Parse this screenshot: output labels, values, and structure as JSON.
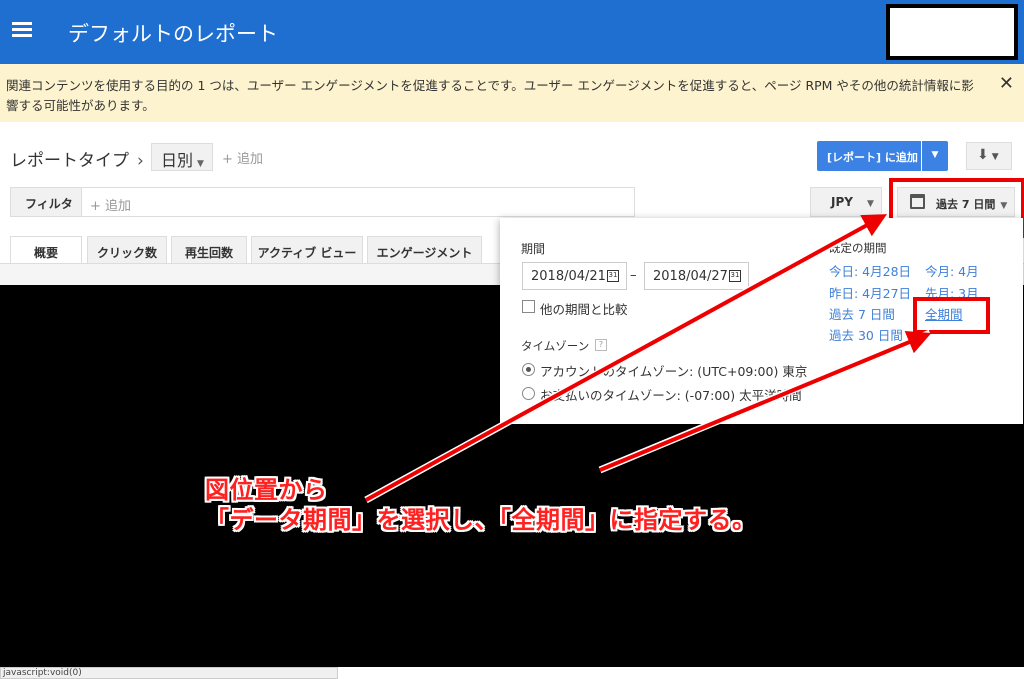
{
  "header": {
    "title": "デフォルトのレポート"
  },
  "notice": {
    "text": "関連コンテンツを使用する目的の 1 つは、ユーザー エンゲージメントを促進することです。ユーザー エンゲージメントを促進すると、ページ RPM やその他の統計情報に影響する可能性があります。",
    "close": "✕"
  },
  "toolbar": {
    "report_type_label": "レポートタイプ",
    "report_type_chevron": "›",
    "daily_label": "日別",
    "add_label": "+ 追加",
    "add_to_report_label": "[レポート] に追加",
    "filter_label": "フィルタ",
    "filter_placeholder": "+ 追加",
    "currency": "JPY",
    "period_label": "過去 7 日間"
  },
  "tabs": [
    "概要",
    "クリック数",
    "再生回数",
    "アクティブ ビュー",
    "エンゲージメント"
  ],
  "date_popup": {
    "period_heading": "期間",
    "start_date": "2018/04/21",
    "end_date": "2018/04/27",
    "cal_glyph": "31",
    "range_dash": "–",
    "compare_label": "他の期間と比較",
    "timezone_heading": "タイムゾーン",
    "timezone_help": "?",
    "timezone_account": "アカウントのタイムゾーン: (UTC+09:00) 東京",
    "timezone_payment": "お支払いのタイムゾーン: (-07:00) 太平洋時間",
    "quick_heading": "既定の期間",
    "quick_today": "今日: 4月28日",
    "quick_this_month": "今月: 4月",
    "quick_yesterday": "昨日: 4月27日",
    "quick_last_month": "先月: 3月",
    "quick_last7": "過去 7 日間",
    "quick_all": "全期間",
    "quick_last30": "過去 30 日間"
  },
  "status_bar": {
    "text": "javascript:void(0)"
  },
  "annotation": {
    "line1": "図位置から",
    "line2": "「データ期間」を選択し、「全期間」に指定する。",
    "color": "#ff2020"
  },
  "colors": {
    "header_bg": "#1f6fd1",
    "notice_bg": "#fdf3cf",
    "primary_button": "#3c82e4",
    "link": "#3f80d8",
    "highlight_red": "#e00000"
  },
  "icons": [
    "menu-icon",
    "chevron-right-icon",
    "caret-down-icon",
    "download-icon",
    "calendar-icon",
    "close-icon",
    "help-icon"
  ]
}
